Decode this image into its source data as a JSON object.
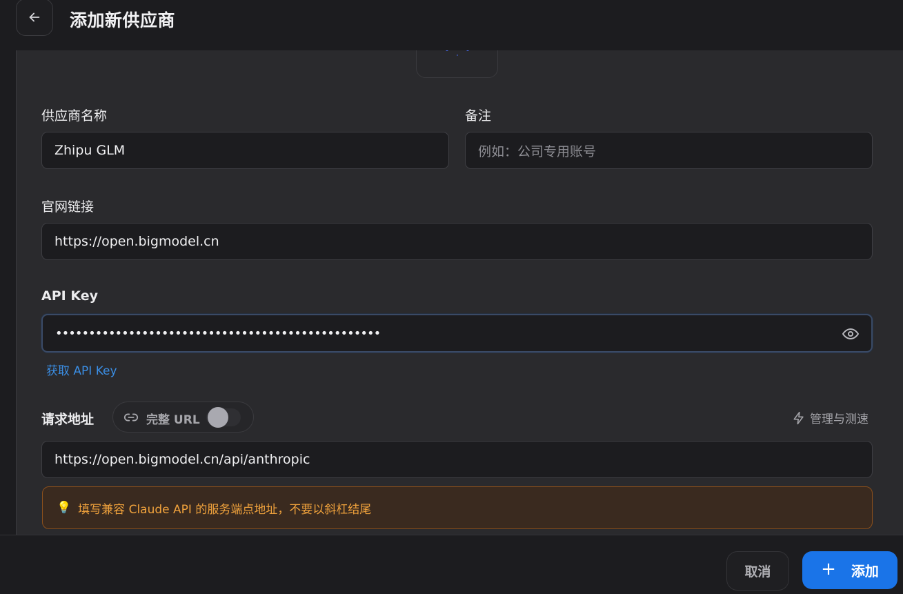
{
  "header": {
    "title": "添加新供应商",
    "back_icon": "arrow-left-icon"
  },
  "form": {
    "provider_name": {
      "label": "供应商名称",
      "value": "Zhipu GLM"
    },
    "notes": {
      "label": "备注",
      "placeholder": "例如：公司专用账号"
    },
    "website": {
      "label": "官网链接",
      "value": "https://open.bigmodel.cn"
    },
    "api_key": {
      "label": "API Key",
      "value_masked": "•••••••••••••••••••••••••••••••••••••••••••••••••",
      "eye_icon": "eye-icon",
      "get_key_link": "获取 API Key"
    },
    "endpoint": {
      "label": "请求地址",
      "full_url_label": "完整 URL",
      "full_url_enabled": false,
      "manage_label": "管理与测速",
      "value": "https://open.bigmodel.cn/api/anthropic",
      "hint": "填写兼容 Claude API 的服务端点地址，不要以斜杠结尾",
      "hint_icon": "💡"
    }
  },
  "footer": {
    "cancel_label": "取消",
    "add_label": "添加",
    "add_icon": "+"
  },
  "colors": {
    "accent": "#1a74e8",
    "link": "#3b8fe6",
    "hint_text": "#f0a23c",
    "hint_border": "#8a4f1c"
  }
}
